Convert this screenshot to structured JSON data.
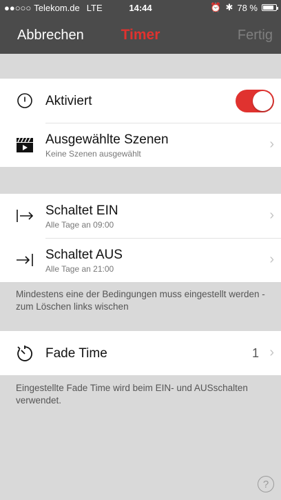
{
  "status": {
    "carrier": "Telekom.de",
    "network": "LTE",
    "time": "14:44",
    "battery": "78 %",
    "signal_dots": "●●○○○"
  },
  "nav": {
    "cancel": "Abbrechen",
    "title": "Timer",
    "done": "Fertig"
  },
  "activated": {
    "label": "Aktiviert",
    "on": true
  },
  "scenes": {
    "label": "Ausgewählte Szenen",
    "sub": "Keine Szenen ausgewählt"
  },
  "switch_on": {
    "label": "Schaltet EIN",
    "sub": "Alle Tage an  09:00"
  },
  "switch_off": {
    "label": "Schaltet AUS",
    "sub": "Alle Tage an  21:00"
  },
  "note1": "Mindestens eine der Bedingungen muss eingestellt werden - zum Löschen links wischen",
  "fade": {
    "label": "Fade Time",
    "value": "1"
  },
  "note2": "Eingestellte Fade Time wird beim EIN- und AUSschalten verwendet.",
  "colors": {
    "accent": "#e0322f",
    "navbar": "#4b4b4b",
    "background": "#d9d9d9"
  }
}
